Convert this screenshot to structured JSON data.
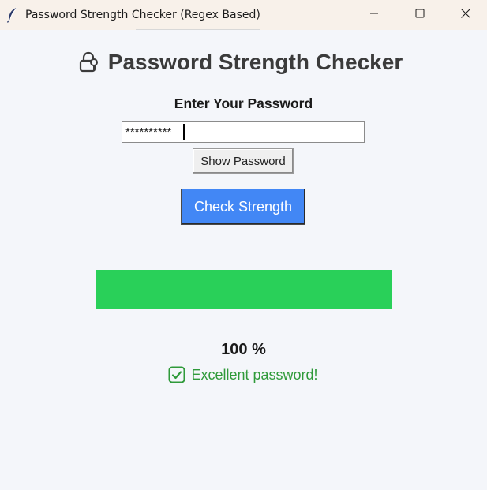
{
  "window": {
    "title": "Password Strength Checker (Regex Based)",
    "icons": {
      "app": "feather-icon",
      "minimize": "minimize-icon",
      "maximize": "maximize-icon",
      "close": "close-icon"
    }
  },
  "header": {
    "title": "Password Strength Checker",
    "icon": "lock-key-icon"
  },
  "form": {
    "label": "Enter Your Password",
    "password_masked": "**********",
    "show_password_label": "Show Password",
    "check_label": "Check Strength",
    "check_color": "#4287f5"
  },
  "result": {
    "strength_fraction": 1.0,
    "meter_color": "#29d059",
    "percent_text": "100 %",
    "message": "Excellent password!",
    "message_icon": "checkbox-check-icon",
    "message_color": "#2f9a3a"
  }
}
